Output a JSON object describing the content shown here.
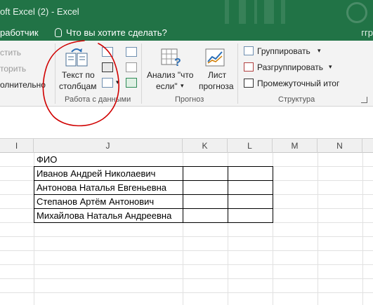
{
  "window": {
    "title": "oft Excel (2) - Excel"
  },
  "menubar": {
    "developer": "работчик",
    "tell_me": "Что вы хотите сделать?",
    "right_clip": "ггр"
  },
  "ribbon": {
    "left_clipped": [
      "стить",
      "торить",
      "олнительно"
    ],
    "data_tools": {
      "text_to_columns_line1": "Текст по",
      "text_to_columns_line2": "столбцам",
      "label": "Работа с данными"
    },
    "forecast": {
      "what_if_line1": "Анализ \"что",
      "what_if_line2": "если\"",
      "forecast_line1": "Лист",
      "forecast_line2": "прогноза",
      "label": "Прогноз"
    },
    "outline": {
      "group": "Группировать",
      "ungroup": "Разгруппировать",
      "subtotal": "Промежуточный итог",
      "label": "Структура"
    }
  },
  "sheet": {
    "columns": [
      "I",
      "J",
      "K",
      "L",
      "M",
      "N"
    ],
    "header_cell": "ФИО",
    "rows": [
      "Иванов Андрей Николаевич",
      "Антонова Наталья Евгеньевна",
      "Степанов Артём Антонович",
      "Михайлова Наталья Андреевна"
    ]
  },
  "colors": {
    "excel_green": "#217346",
    "annotation": "#d00000"
  },
  "icons": [
    "lightbulb-icon",
    "text-to-columns-icon",
    "flash-fill-icon",
    "remove-duplicates-icon",
    "data-validation-icon",
    "consolidate-icon",
    "relationships-icon",
    "manage-data-model-icon",
    "what-if-icon",
    "forecast-sheet-icon",
    "group-icon",
    "ungroup-icon",
    "subtotal-icon",
    "dialog-launcher-icon"
  ]
}
